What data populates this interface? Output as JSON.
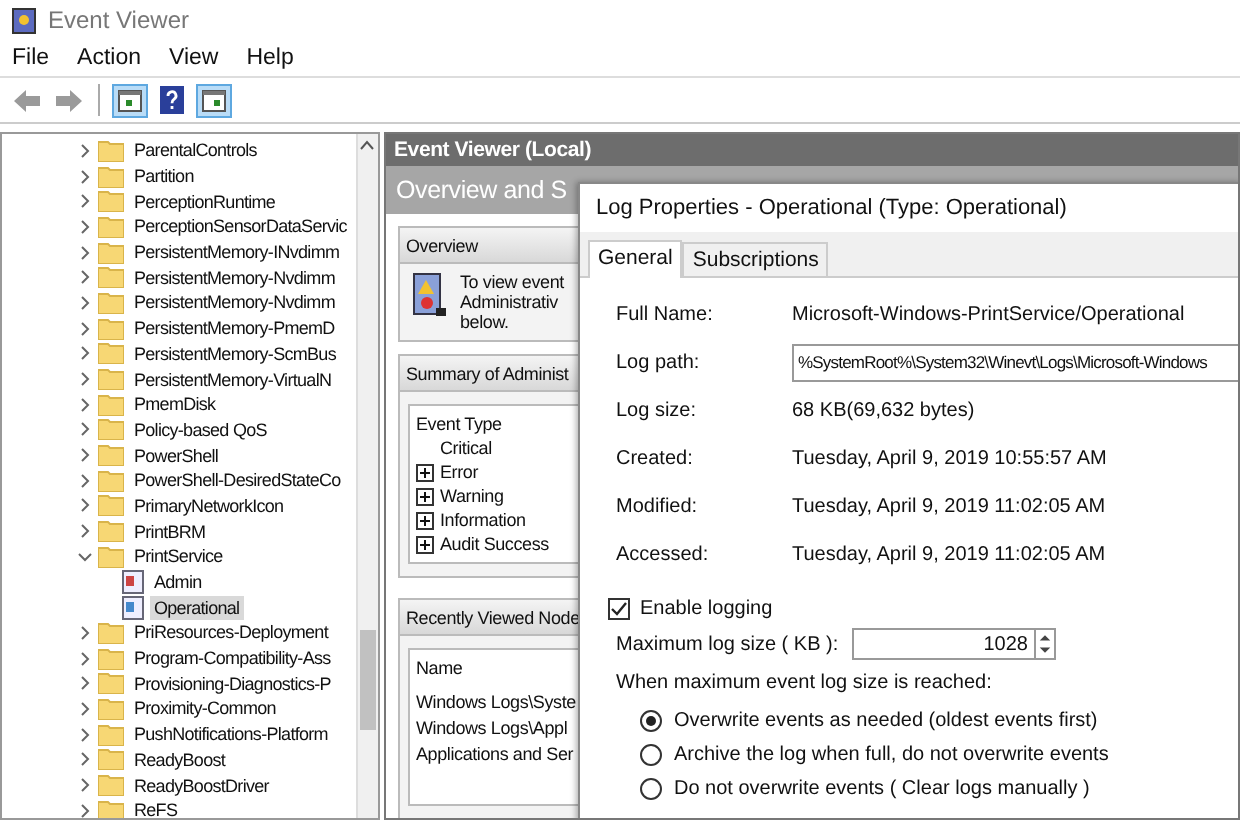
{
  "window": {
    "title": "Event Viewer"
  },
  "menu": [
    "File",
    "Action",
    "View",
    "Help"
  ],
  "toolbar": [
    {
      "kind": "back",
      "pressed": false
    },
    {
      "kind": "forward",
      "pressed": false
    },
    {
      "kind": "separator"
    },
    {
      "kind": "console",
      "pressed": true
    },
    {
      "kind": "help",
      "pressed": false
    },
    {
      "kind": "pane",
      "pressed": true
    }
  ],
  "tree": [
    {
      "label": "ParentalControls",
      "expanded": false,
      "selected": false
    },
    {
      "label": "Partition",
      "expanded": false,
      "selected": false
    },
    {
      "label": "PerceptionRuntime",
      "expanded": false,
      "selected": false
    },
    {
      "label": "PerceptionSensorDataServic",
      "expanded": false,
      "selected": false
    },
    {
      "label": "PersistentMemory-INvdimm",
      "expanded": false,
      "selected": false
    },
    {
      "label": "PersistentMemory-Nvdimm",
      "expanded": false,
      "selected": false
    },
    {
      "label": "PersistentMemory-Nvdimm",
      "expanded": false,
      "selected": false
    },
    {
      "label": "PersistentMemory-PmemD",
      "expanded": false,
      "selected": false
    },
    {
      "label": "PersistentMemory-ScmBus",
      "expanded": false,
      "selected": false
    },
    {
      "label": "PersistentMemory-VirtualN",
      "expanded": false,
      "selected": false
    },
    {
      "label": "PmemDisk",
      "expanded": false,
      "selected": false
    },
    {
      "label": "Policy-based QoS",
      "expanded": false,
      "selected": false
    },
    {
      "label": "PowerShell",
      "expanded": false,
      "selected": false
    },
    {
      "label": "PowerShell-DesiredStateCo",
      "expanded": false,
      "selected": false
    },
    {
      "label": "PrimaryNetworkIcon",
      "expanded": false,
      "selected": false
    },
    {
      "label": "PrintBRM",
      "expanded": false,
      "selected": false
    },
    {
      "label": "PrintService",
      "expanded": true,
      "selected": false,
      "children": [
        {
          "label": "Admin",
          "selected": false
        },
        {
          "label": "Operational",
          "selected": true
        }
      ]
    },
    {
      "label": "PriResources-Deployment",
      "expanded": false,
      "selected": false
    },
    {
      "label": "Program-Compatibility-Ass",
      "expanded": false,
      "selected": false
    },
    {
      "label": "Provisioning-Diagnostics-P",
      "expanded": false,
      "selected": false
    },
    {
      "label": "Proximity-Common",
      "expanded": false,
      "selected": false
    },
    {
      "label": "PushNotifications-Platform",
      "expanded": false,
      "selected": false
    },
    {
      "label": "ReadyBoost",
      "expanded": false,
      "selected": false
    },
    {
      "label": "ReadyBoostDriver",
      "expanded": false,
      "selected": false
    },
    {
      "label": "ReFS",
      "expanded": false,
      "selected": false
    }
  ],
  "center": {
    "header": "Event Viewer (Local)",
    "banner": "Overview and S",
    "overview": {
      "title": "Overview",
      "lines": [
        "To view event",
        "Administrativ",
        "below."
      ]
    },
    "summary": {
      "title": "Summary of Administ",
      "column": "Event Type",
      "rows": [
        {
          "label": "Critical",
          "expandable": false
        },
        {
          "label": "Error",
          "expandable": true
        },
        {
          "label": "Warning",
          "expandable": true
        },
        {
          "label": "Information",
          "expandable": true
        },
        {
          "label": "Audit Success",
          "expandable": true
        }
      ]
    },
    "recent": {
      "title": "Recently Viewed Node",
      "column": "Name",
      "rows": [
        "Windows Logs\\Syste",
        "Windows Logs\\Appl",
        "Applications and Ser"
      ]
    }
  },
  "dialog": {
    "title": "Log Properties - Operational (Type: Operational)",
    "tabs": [
      {
        "label": "General",
        "selected": true
      },
      {
        "label": "Subscriptions",
        "selected": false
      }
    ],
    "fields": [
      {
        "kind": "text",
        "label": "Full Name:",
        "value": "Microsoft-Windows-PrintService/Operational"
      },
      {
        "kind": "input",
        "label": "Log path:",
        "value": "%SystemRoot%\\System32\\Winevt\\Logs\\Microsoft-Windows"
      },
      {
        "kind": "text",
        "label": "Log size:",
        "value": "68 KB(69,632 bytes)"
      },
      {
        "kind": "text",
        "label": "Created:",
        "value": "Tuesday, April 9, 2019 10:55:57 AM"
      },
      {
        "kind": "text",
        "label": "Modified:",
        "value": "Tuesday, April 9, 2019 11:02:05 AM"
      },
      {
        "kind": "text",
        "label": "Accessed:",
        "value": "Tuesday, April 9, 2019 11:02:05 AM"
      }
    ],
    "enable_logging": {
      "label": "Enable logging",
      "checked": true
    },
    "max_size": {
      "label": "Maximum log size ( KB ):",
      "value": "1028"
    },
    "policy_label": "When maximum event log size is reached:",
    "policies": [
      {
        "label": "Overwrite events as needed (oldest events first)",
        "selected": true
      },
      {
        "label": "Archive the log when full, do not overwrite events",
        "selected": false
      },
      {
        "label": "Do not overwrite events ( Clear logs manually )",
        "selected": false
      }
    ]
  }
}
